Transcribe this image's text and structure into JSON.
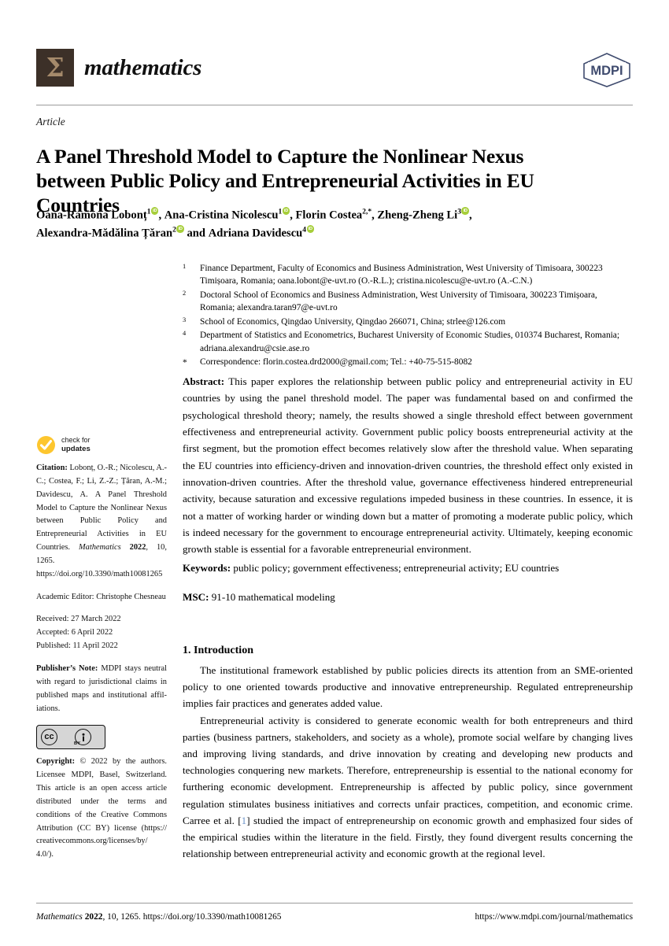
{
  "header": {
    "journal_logo_sigma": "Σ",
    "journal_name": "mathematics",
    "publisher_logo_text": "MDPI",
    "logo_box_color": "#3c3028",
    "logo_sigma_color": "#a58a6b",
    "publisher_logo_color": "#3f4b6e"
  },
  "article": {
    "type": "Article",
    "title": "A Panel Threshold Model to Capture the Nonlinear Nexus between Public Policy and Entrepreneurial Activities in EU Countries",
    "authors_line_1": "Oana-Ramona Lobonț 1, Ana-Cristina Nicolescu 1, Florin Costea 2,*, Zheng-Zheng Li 3,",
    "authors_line_2": "Alexandra-Mădălina Țăran 2 and Adriana Davidescu 4",
    "authors": [
      {
        "name": "Oana-Ramona Lobonț",
        "affiliation_marker": "1",
        "orcid": true
      },
      {
        "name": "Ana-Cristina Nicolescu",
        "affiliation_marker": "1",
        "orcid": true
      },
      {
        "name": "Florin Costea",
        "affiliation_marker": "2,*",
        "orcid": false
      },
      {
        "name": "Zheng-Zheng Li",
        "affiliation_marker": "3",
        "orcid": true
      },
      {
        "name": "Alexandra-Mădălina Țăran",
        "affiliation_marker": "2",
        "orcid": true
      },
      {
        "name": "Adriana Davidescu",
        "affiliation_marker": "4",
        "orcid": true
      }
    ]
  },
  "affiliations": [
    {
      "marker": "1",
      "text": "Finance Department, Faculty of Economics and Business Administration, West University of Timisoara, 300223 Timișoara, Romania; oana.lobont@e-uvt.ro (O.-R.L.); cristina.nicolescu@e-uvt.ro (A.-C.N.)"
    },
    {
      "marker": "2",
      "text": "Doctoral School of Economics and Business Administration, West University of Timisoara, 300223 Timișoara, Romania; alexandra.taran97@e-uvt.ro"
    },
    {
      "marker": "3",
      "text": "School of Economics, Qingdao University, Qingdao 266071, China; strlee@126.com"
    },
    {
      "marker": "4",
      "text": "Department of Statistics and Econometrics, Bucharest University of Economic Studies, 010374 Bucharest, Romania; adriana.alexandru@csie.ase.ro"
    },
    {
      "marker": "*",
      "text": "Correspondence: florin.costea.drd2000@gmail.com; Tel.: +40-75-515-8082"
    }
  ],
  "abstract": {
    "label": "Abstract:",
    "text": "This paper explores the relationship between public policy and entrepreneurial activity in EU countries by using the panel threshold model. The paper was fundamental based on and confirmed the psychological threshold theory; namely, the results showed a single threshold effect between government effectiveness and entrepreneurial activity. Government public policy boosts entrepreneurial activity at the first segment, but the promotion effect becomes relatively slow after the threshold value. When separating the EU countries into efficiency-driven and innovation-driven countries, the threshold effect only existed in innovation-driven countries. After the threshold value, governance effectiveness hindered entrepreneurial activity, because saturation and excessive regulations impeded business in these countries. In essence, it is not a matter of working harder or winding down but a matter of promoting a moderate public policy, which is indeed necessary for the government to encourage entrepreneurial activity. Ultimately, keeping economic growth stable is essential for a favorable entrepreneurial environment."
  },
  "keywords": {
    "label": "Keywords:",
    "text": "public policy; government effectiveness; entrepreneurial activity; EU countries"
  },
  "msc": {
    "label": "MSC:",
    "text": "91-10 mathematical modeling"
  },
  "section": {
    "heading": "1. Introduction",
    "paragraphs": [
      "The institutional framework established by public policies directs its attention from an SME-oriented policy to one oriented towards productive and innovative entrepreneurship. Regulated entrepreneurship implies fair practices and generates added value.",
      "Entrepreneurial activity is considered to generate economic wealth for both entrepreneurs and third parties (business partners, stakeholders, and society as a whole), promote social welfare by changing lives and improving living standards, and drive innovation by creating and developing new products and technologies conquering new markets. Therefore, entrepreneurship is essential to the national economy for furthering economic development. Entrepreneurship is affected by public policy, since government regulation stimulates business initiatives and corrects unfair practices, competition, and economic crime. Carree et al. [1] studied the impact of entrepreneurship on economic growth and emphasized four sides of the empirical studies within the literature in the field. Firstly, they found divergent results concerning the relationship between entrepreneurial activity and economic growth at the regional level."
    ],
    "reference_marker": "1"
  },
  "sidebar": {
    "check_for_updates": {
      "line1": "check for",
      "line2": "updates",
      "badge_color": "#fdc62e"
    },
    "citation": {
      "label": "Citation:",
      "text_before_journal": "Lobonț, O.-R.; Nicolescu, A.-C.; Costea, F.; Li, Z.-Z.; Țăran, A.-M.; Davidescu, A. A Panel Threshold Model to Capture the Nonlinear Nexus between Public Policy and Entrepreneurial Activities in EU Countries.",
      "journal": "Mathematics",
      "year": "2022",
      "volume_page": ", 10, 1265.",
      "doi": "https://doi.org/10.3390/math10081265"
    },
    "academic_editor": {
      "label": "Academic Editor:",
      "name": "Christophe Chesneau"
    },
    "dates": [
      "Received: 27 March 2022",
      "Accepted: 6 April 2022",
      "Published: 11 April 2022"
    ],
    "publisher_note": {
      "label": "Publisher’s Note:",
      "text": "MDPI stays neutral with regard to jurisdictional claims in published maps and institutional affil-iations."
    },
    "cc_badge": {
      "cc_text": "cc",
      "by_text": "BY",
      "person_glyph": "i"
    },
    "copyright": {
      "label": "Copyright:",
      "text": "© 2022 by the authors. Licensee MDPI, Basel, Switzerland. This article is an open access article distributed under the terms and conditions of the Creative Commons Attribution (CC BY) license (https:// creativecommons.org/licenses/by/ 4.0/)."
    }
  },
  "footer": {
    "left_journal": "Mathematics",
    "left_year": "2022",
    "left_rest": ", 10, 1265. https://doi.org/10.3390/math10081265",
    "right": "https://www.mdpi.com/journal/mathematics"
  }
}
